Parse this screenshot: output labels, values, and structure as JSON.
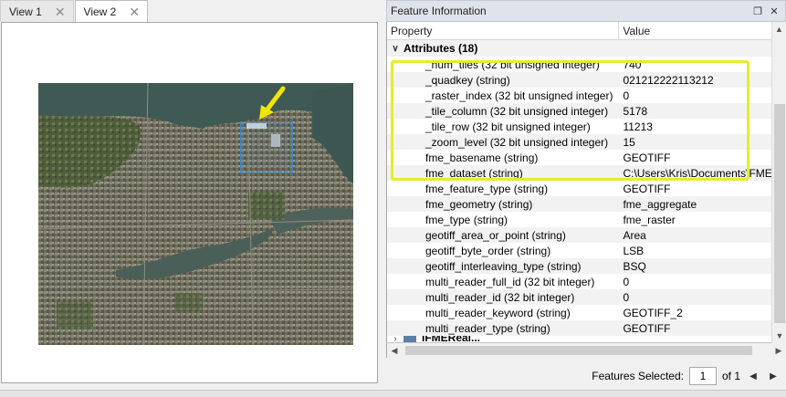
{
  "view_tabs": [
    {
      "label": "View 1",
      "active": false
    },
    {
      "label": "View 2",
      "active": true
    }
  ],
  "panel": {
    "title": "Feature Information",
    "columns": {
      "property": "Property",
      "value": "Value"
    },
    "group_label": "Attributes (18)",
    "partial_bottom_label": "IFMEReal..."
  },
  "rows": [
    {
      "property": "_num_tiles (32 bit unsigned integer)",
      "value": "740"
    },
    {
      "property": "_quadkey (string)",
      "value": "021212222113212"
    },
    {
      "property": "_raster_index (32 bit unsigned integer)",
      "value": "0"
    },
    {
      "property": "_tile_column (32 bit unsigned integer)",
      "value": "5178"
    },
    {
      "property": "_tile_row (32 bit unsigned integer)",
      "value": "11213"
    },
    {
      "property": "_zoom_level (32 bit unsigned integer)",
      "value": "15"
    },
    {
      "property": "fme_basename (string)",
      "value": "GEOTIFF"
    },
    {
      "property": "fme_dataset (string)",
      "value": "C:\\Users\\Kris\\Documents\\FME"
    },
    {
      "property": "fme_feature_type (string)",
      "value": "GEOTIFF"
    },
    {
      "property": "fme_geometry (string)",
      "value": "fme_aggregate"
    },
    {
      "property": "fme_type (string)",
      "value": "fme_raster"
    },
    {
      "property": "geotiff_area_or_point (string)",
      "value": "Area"
    },
    {
      "property": "geotiff_byte_order (string)",
      "value": "LSB"
    },
    {
      "property": "geotiff_interleaving_type (string)",
      "value": "BSQ"
    },
    {
      "property": "multi_reader_full_id (32 bit integer)",
      "value": "0"
    },
    {
      "property": "multi_reader_id (32 bit integer)",
      "value": "0"
    },
    {
      "property": "multi_reader_keyword (string)",
      "value": "GEOTIFF_2"
    },
    {
      "property": "multi_reader_type (string)",
      "value": "GEOTIFF"
    }
  ],
  "footer": {
    "features_selected_label": "Features Selected:",
    "page_value": "1",
    "of_label": "of 1"
  },
  "colors": {
    "highlight": "#e6ec2a",
    "arrow": "#f2e600",
    "selection_box": "#3a86c8"
  },
  "icons": [
    "close-icon",
    "float-icon",
    "panel-close-icon",
    "chevron-down-icon",
    "arrow-up-icon",
    "arrow-down-icon",
    "arrow-left-icon",
    "arrow-right-icon",
    "annotation-arrow-icon"
  ]
}
